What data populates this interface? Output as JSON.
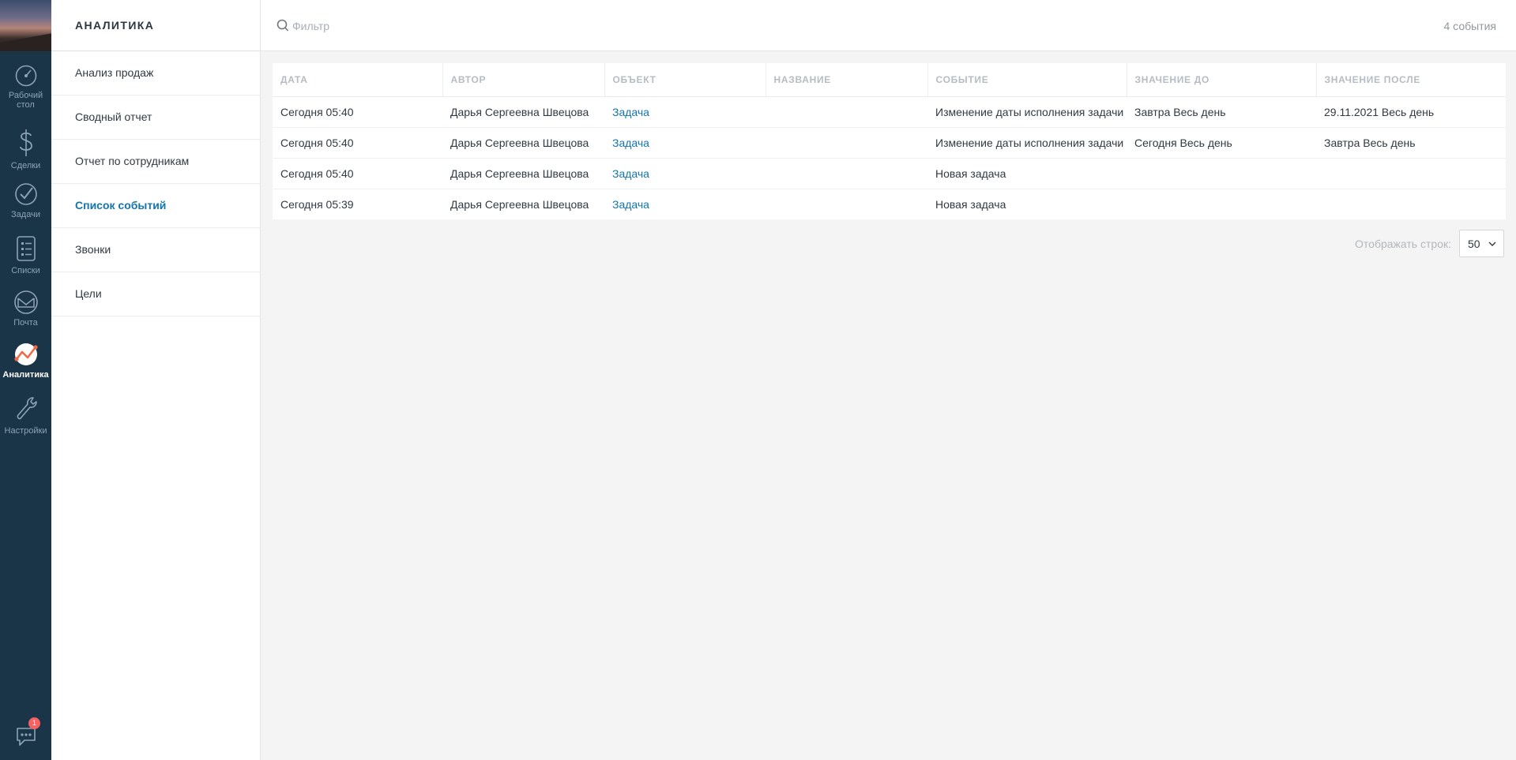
{
  "nav": {
    "items": [
      {
        "label": "Рабочий стол",
        "icon": "dashboard-icon"
      },
      {
        "label": "Сделки",
        "icon": "dollar-icon"
      },
      {
        "label": "Задачи",
        "icon": "check-icon"
      },
      {
        "label": "Списки",
        "icon": "list-icon"
      },
      {
        "label": "Почта",
        "icon": "mail-icon"
      },
      {
        "label": "Аналитика",
        "icon": "analytics-icon"
      },
      {
        "label": "Настройки",
        "icon": "wrench-icon"
      }
    ],
    "chat_badge": "1"
  },
  "sidebar": {
    "title": "АНАЛИТИКА",
    "items": [
      {
        "label": "Анализ продаж"
      },
      {
        "label": "Сводный отчет"
      },
      {
        "label": "Отчет по сотрудникам"
      },
      {
        "label": "Список событий"
      },
      {
        "label": "Звонки"
      },
      {
        "label": "Цели"
      }
    ]
  },
  "topbar": {
    "filter_placeholder": "Фильтр",
    "events_count": "4 события"
  },
  "table": {
    "columns": [
      "ДАТА",
      "АВТОР",
      "ОБЪЕКТ",
      "НАЗВАНИЕ",
      "СОБЫТИЕ",
      "ЗНАЧЕНИЕ ДО",
      "ЗНАЧЕНИЕ ПОСЛЕ"
    ],
    "rows": [
      {
        "date": "Сегодня 05:40",
        "author": "Дарья Сергеевна Швецова",
        "object": "Задача",
        "name": "",
        "event": "Изменение даты исполнения задачи",
        "before": "Завтра Весь день",
        "after": "29.11.2021 Весь день"
      },
      {
        "date": "Сегодня 05:40",
        "author": "Дарья Сергеевна Швецова",
        "object": "Задача",
        "name": "",
        "event": "Изменение даты исполнения задачи",
        "before": "Сегодня Весь день",
        "after": "Завтра Весь день"
      },
      {
        "date": "Сегодня 05:40",
        "author": "Дарья Сергеевна Швецова",
        "object": "Задача",
        "name": "",
        "event": "Новая задача",
        "before": "",
        "after": ""
      },
      {
        "date": "Сегодня 05:39",
        "author": "Дарья Сергеевна Швецова",
        "object": "Задача",
        "name": "",
        "event": "Новая задача",
        "before": "",
        "after": ""
      }
    ]
  },
  "pager": {
    "label": "Отображать строк:",
    "value": "50"
  },
  "colors": {
    "nav_bg": "#1b3548",
    "accent": "#1375ab",
    "badge": "#f86161",
    "analytics_icon": "#f06a4a"
  }
}
